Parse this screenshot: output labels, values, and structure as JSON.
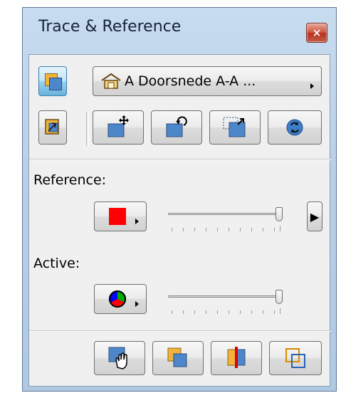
{
  "window": {
    "title": "Trace & Reference",
    "close_glyph": "×"
  },
  "toolbar": {
    "reference_picker_label": "A Doorsnede A-A ...",
    "toggle_trace_icon": "trace-toggle-icon",
    "building_icon": "building-icon"
  },
  "tools_row": [
    "switch-reference-icon",
    "move-reference-icon",
    "rotate-reference-icon",
    "mirror-reference-icon",
    "reset-reference-icon"
  ],
  "reference": {
    "label": "Reference:",
    "color": "#ff0000",
    "slider_value": 1.0,
    "expand_label": "▶"
  },
  "active": {
    "label": "Active:",
    "slider_value": 1.0
  },
  "bottom_tools": [
    "drag-compare-icon",
    "show-reference-on-top-icon",
    "compare-split-icon",
    "compare-outline-icon"
  ],
  "colors": {
    "accent": "#68b3db",
    "title_bar": "#b8cfe7",
    "red": "#ff0000"
  }
}
